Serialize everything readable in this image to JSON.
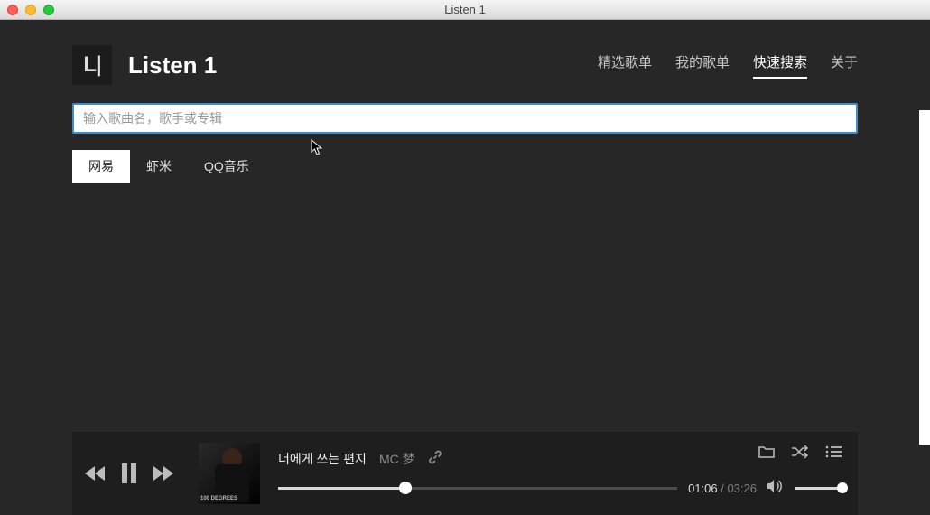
{
  "window": {
    "title": "Listen 1"
  },
  "brand": {
    "title": "Listen 1",
    "logo_text": "L|"
  },
  "nav": {
    "items": [
      {
        "label": "精选歌单",
        "active": false
      },
      {
        "label": "我的歌单",
        "active": false
      },
      {
        "label": "快速搜索",
        "active": true
      },
      {
        "label": "关于",
        "active": false
      }
    ]
  },
  "search": {
    "placeholder": "输入歌曲名，歌手或专辑",
    "value": ""
  },
  "tabs": {
    "items": [
      {
        "label": "网易",
        "active": true
      },
      {
        "label": "虾米",
        "active": false
      },
      {
        "label": "QQ音乐",
        "active": false
      }
    ]
  },
  "player": {
    "track_title": "너에게 쓰는 편지",
    "artist": "MC 梦",
    "current_time": "01:06",
    "duration": "03:26",
    "time_separator": " / ",
    "album_art_text": "100 DEGREES"
  }
}
